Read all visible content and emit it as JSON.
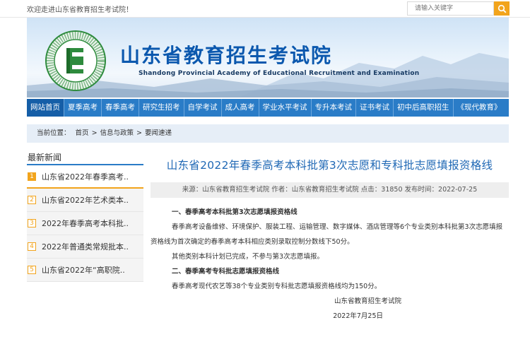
{
  "topbar": {
    "welcome": "欢迎走进山东省教育招生考试院！",
    "search_placeholder": "请输入关键字"
  },
  "banner": {
    "title_cn": "山东省教育招生考试院",
    "title_en": "Shandong Provincial Academy of Educational Recruitment and Examination",
    "logo_letter": "E",
    "logo_ring_text": "Shandong Educational Admission & Examination",
    "logo_ring_text_cn": "山东省教育招生考试院"
  },
  "nav": {
    "items": [
      "网站首页",
      "夏季高考",
      "春季高考",
      "研究生招考",
      "自学考试",
      "成人高考",
      "学业水平考试",
      "专升本考试",
      "证书考试",
      "初中后高职招生",
      "《现代教育》"
    ]
  },
  "breadcrumb": {
    "label": "当前位置：",
    "items": [
      "首页",
      ">",
      "信息与政策",
      ">",
      "要闻速递"
    ]
  },
  "sidebar": {
    "title": "最新新闻",
    "items": [
      {
        "num": "1",
        "label": "山东省2022年春季高考.."
      },
      {
        "num": "2",
        "label": "山东省2022年艺术类本.."
      },
      {
        "num": "3",
        "label": "2022年春季高考本科批.."
      },
      {
        "num": "4",
        "label": "2022年普通类常规批本.."
      },
      {
        "num": "5",
        "label": "山东省2022年“高职院.."
      }
    ]
  },
  "article": {
    "title": "山东省2022年春季高考本科批第3次志愿和专科批志愿填报资格线",
    "meta": "来源：山东省教育招生考试院 作者：山东省教育招生考试院 点击：31850 发布时间：2022-07-25",
    "section1": "一、春季高考本科批第3次志愿填报资格线",
    "para1": "春季高考设备维修、环境保护、服装工程、运输管理、数字媒体、酒店管理等6个专业类别本科批第3次志愿填报资格线为首次确定的春季高考本科相应类别录取控制分数线下50分。",
    "para2": "其他类别本科计划已完成，不参与第3次志愿填报。",
    "section2": "二、春季高考专科批志愿填报资格线",
    "para3": "春季高考现代农艺等38个专业类别专科批志愿填报资格线均为150分。",
    "signature": "山东省教育招生考试院",
    "date": "2022年7月25日"
  },
  "colors": {
    "nav_bg": "#2a7cc7",
    "nav_active": "#155ea7",
    "accent_orange": "#f2a41c",
    "title_blue": "#1f68b5",
    "banner_title": "#0b58ae"
  }
}
